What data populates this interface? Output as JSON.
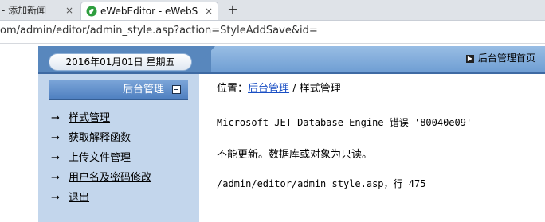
{
  "browser": {
    "tabs": [
      {
        "title": "- 添加新闻"
      },
      {
        "title": "eWebEditor - eWebS"
      }
    ],
    "close_glyph": "×",
    "new_tab_glyph": "+",
    "url": "om/admin/editor/admin_style.asp?action=StyleAddSave&id="
  },
  "header": {
    "date": "2016年01月01日  星期五",
    "home_link": "后台管理首页"
  },
  "sidebar": {
    "title": "后台管理",
    "arrow": "→",
    "items": [
      {
        "label": "样式管理"
      },
      {
        "label": "获取解释函数"
      },
      {
        "label": "上传文件管理"
      },
      {
        "label": "用户名及密码修改"
      },
      {
        "label": "退出"
      }
    ]
  },
  "content": {
    "location_prefix": "位置：",
    "location_link": "后台管理",
    "location_sep": " / ",
    "location_current": "样式管理",
    "error_line1": "Microsoft JET Database Engine 错误 '80040e09'",
    "error_line2": "不能更新。数据库或对象为只读。",
    "error_line3": "/admin/editor/admin_style.asp，行 475"
  },
  "colors": {
    "header_blue": "#5887bd",
    "sidebar_bg": "#c3d6ec",
    "link": "#1a4fc4"
  }
}
